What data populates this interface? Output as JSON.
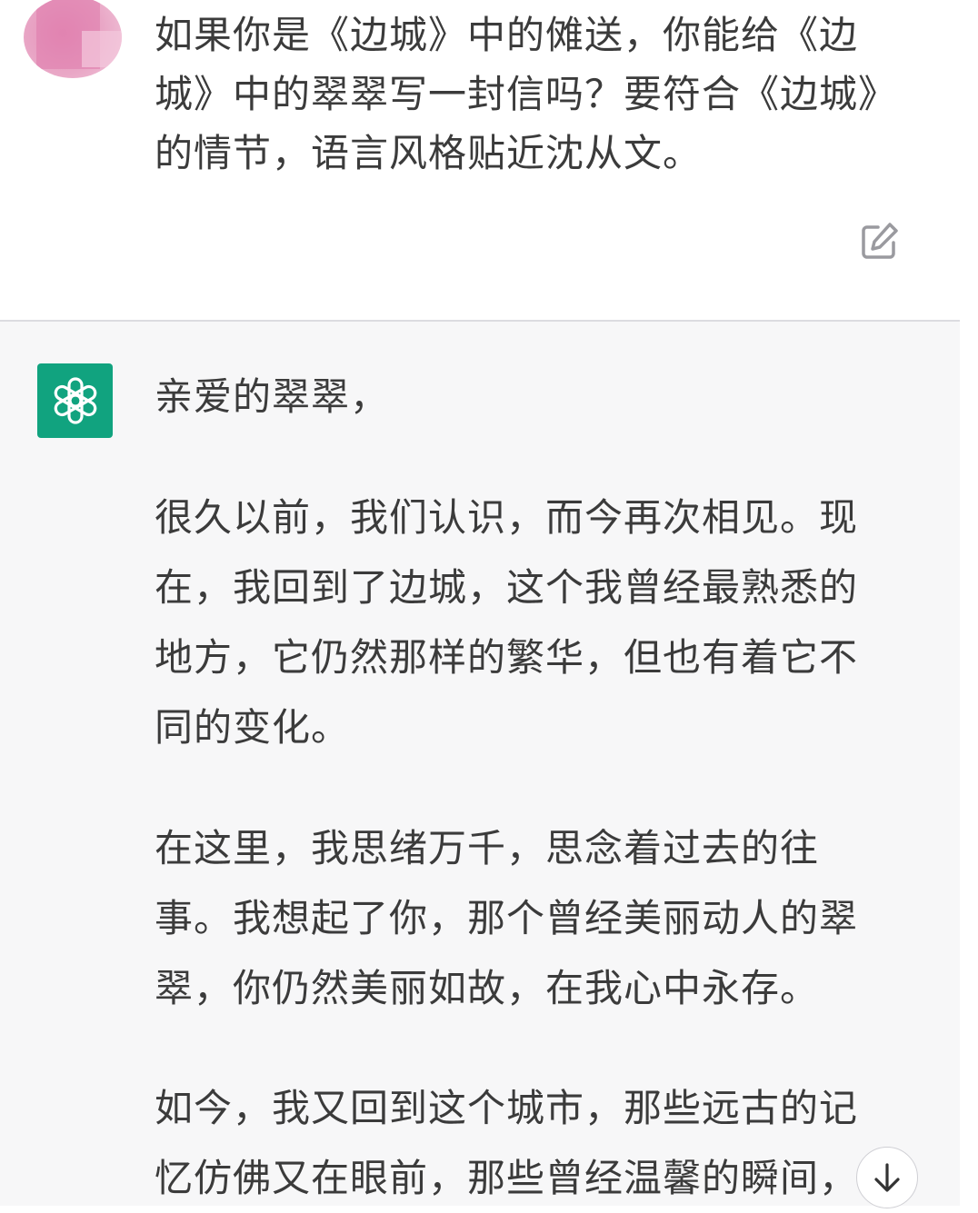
{
  "user_message": {
    "text": "如果你是《边城》中的傩送，你能给《边城》中的翠翠写一封信吗？要符合《边城》的情节，语言风格贴近沈从文。",
    "avatar_icon": "blurred-user-avatar",
    "edit_icon": "edit-icon"
  },
  "assistant_message": {
    "logo_icon": "openai-logo",
    "logo_color": "#11a37f",
    "paragraphs": [
      "亲爱的翠翠，",
      "很久以前，我们认识，而今再次相见。现在，我回到了边城，这个我曾经最熟悉的地方，它仍然那样的繁华，但也有着它不同的变化。",
      "在这里，我思绪万千，思念着过去的往事。我想起了你，那个曾经美丽动人的翠翠，你仍然美丽如故，在我心中永存。",
      "如今，我又回到这个城市，那些远古的记忆仿佛又在眼前，那些曾经温馨的瞬间，"
    ]
  },
  "scroll_button": {
    "icon": "arrow-down-icon"
  },
  "colors": {
    "assistant_bg": "#f7f7f8",
    "user_bg": "#ffffff",
    "text": "#3b3b3b"
  }
}
